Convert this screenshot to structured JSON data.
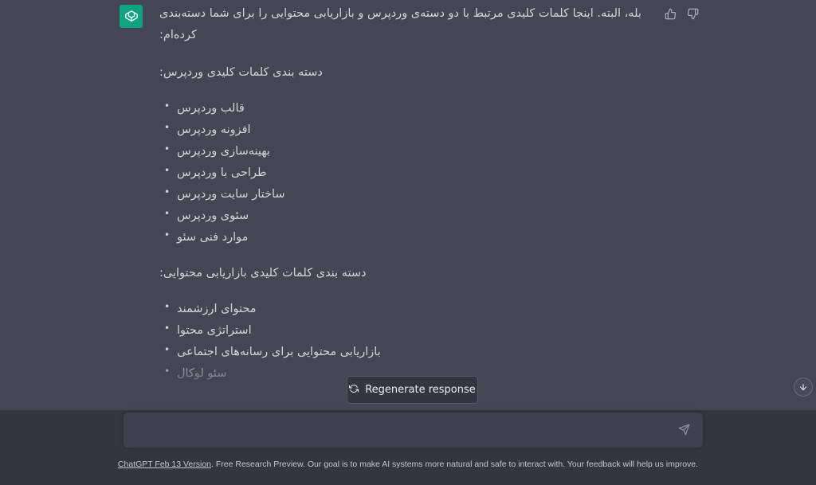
{
  "assistant_message": {
    "intro": "بله، البته. اینجا کلمات کلیدی مرتبط با دو دسته‌ی وردپرس و بازاریابی محتوایی را برای شما دسته‌بندی کرده‌ام:",
    "sections": [
      {
        "title": "دسته بندی کلمات کلیدی وردپرس:",
        "items": [
          "قالب وردپرس",
          "افزونه وردپرس",
          "بهینه‌سازی وردپرس",
          "طراحی با وردپرس",
          "ساختار سایت وردپرس",
          "سئوی وردپرس",
          "موارد فنی سئو"
        ]
      },
      {
        "title": "دسته بندی کلمات کلیدی بازاریابی محتوایی:",
        "items": [
          "محتوای ارزشمند",
          "استراتژی محتوا",
          "بازاریابی محتوایی برای رسانه‌های اجتماعی",
          "سئو لوکال"
        ]
      }
    ]
  },
  "regenerate_label": "Regenerate response",
  "input": {
    "value": "",
    "placeholder": ""
  },
  "footer": {
    "version_link": "ChatGPT Feb 13 Version",
    "text": ". Free Research Preview. Our goal is to make AI systems more natural and safe to interact with. Your feedback will help us improve."
  },
  "colors": {
    "avatar": "#10a37f",
    "message_bg": "#444654",
    "page_bg": "#343541",
    "input_bg": "#40414f"
  },
  "icons": [
    "openai-logo-icon",
    "thumbs-up-icon",
    "thumbs-down-icon",
    "refresh-icon",
    "arrow-down-icon",
    "send-icon"
  ]
}
